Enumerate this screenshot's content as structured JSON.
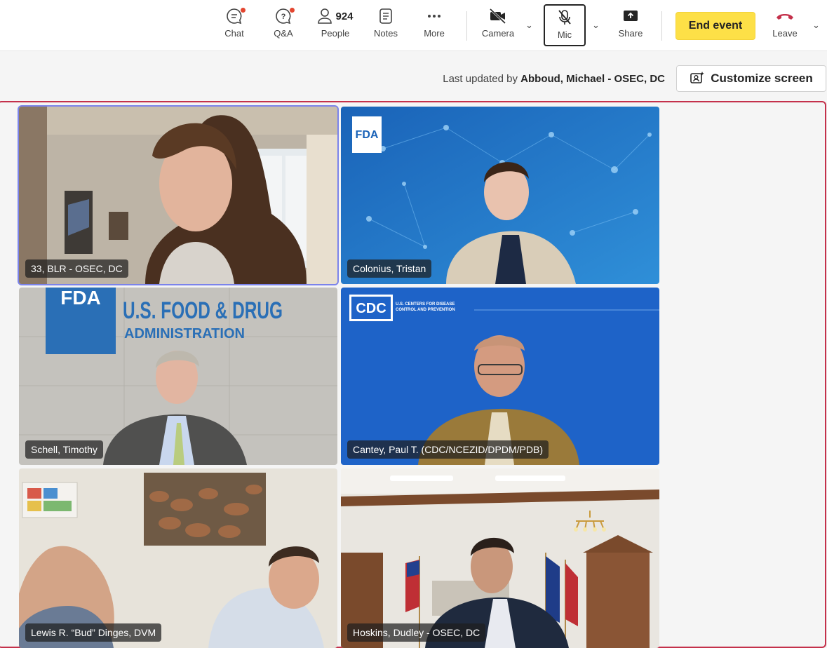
{
  "toolbar": {
    "chat_label": "Chat",
    "qa_label": "Q&A",
    "people_label": "People",
    "people_count": "924",
    "notes_label": "Notes",
    "more_label": "More",
    "camera_label": "Camera",
    "mic_label": "Mic",
    "share_label": "Share",
    "end_event_label": "End event",
    "leave_label": "Leave",
    "colors": {
      "end_event_bg": "#fde047",
      "leave_icon": "#c4314b",
      "notification_dot": "#e3452f"
    }
  },
  "subbar": {
    "last_updated_prefix": "Last updated by ",
    "last_updated_name": "Abboud, Michael - OSEC, DC",
    "customize_label": "Customize screen"
  },
  "tiles": [
    {
      "name": "33, BLR - OSEC, DC",
      "active": true
    },
    {
      "name": "Colonius, Tristan",
      "logo": "FDA"
    },
    {
      "name": "Schell, Timothy",
      "sign_main": "U.S. FOOD & DRUG",
      "sign_sub": "ADMINISTRATION",
      "sign_logo": "FDA"
    },
    {
      "name": "Cantey, Paul T. (CDC/NCEZID/DPDM/PDB)",
      "logo": "CDC",
      "logo_sub1": "U.S. CENTERS FOR DISEASE",
      "logo_sub2": "CONTROL AND PREVENTION"
    },
    {
      "name": "Lewis R. “Bud” Dinges, DVM"
    },
    {
      "name": "Hoskins, Dudley - OSEC, DC"
    }
  ],
  "stage": {
    "border_color": "#c4314b",
    "active_speaker_color": "#7b83eb"
  }
}
